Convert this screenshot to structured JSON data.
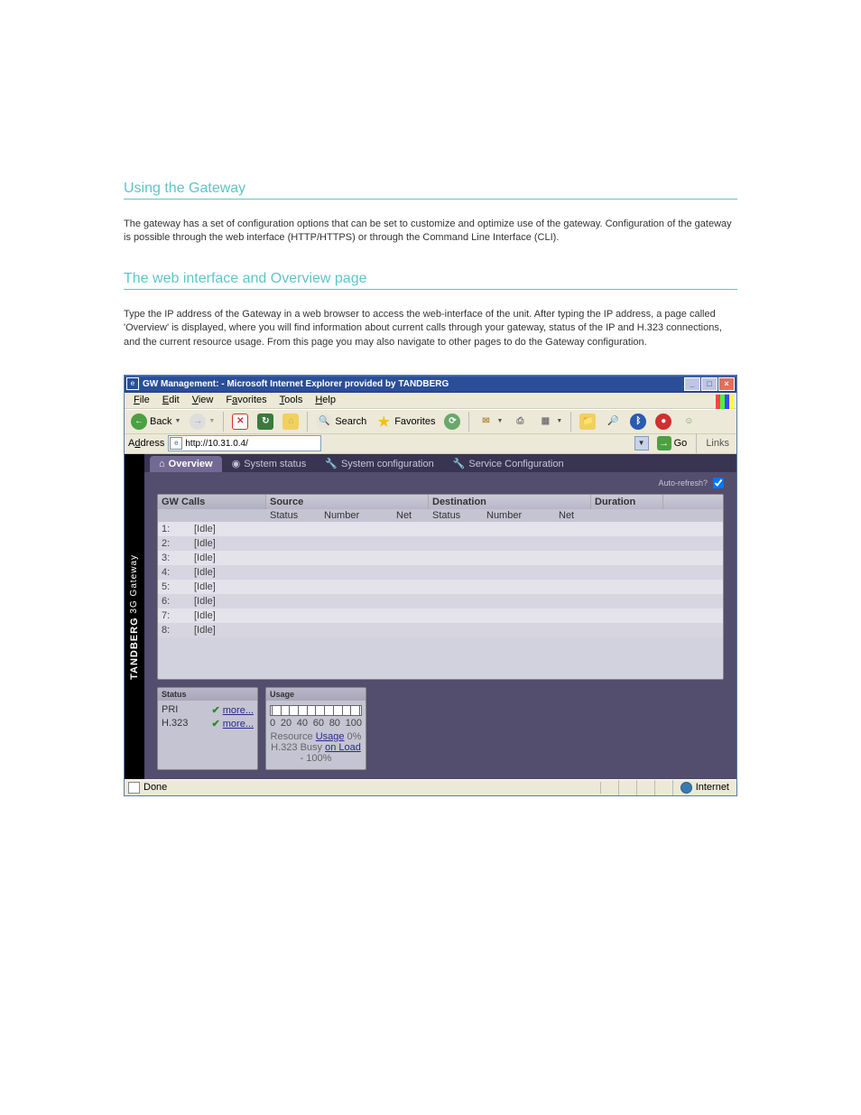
{
  "doc": {
    "sec1_title": "Using the Gateway",
    "sec1_body": "The gateway has a set of configuration options that can be set to customize and optimize use of the gateway. Configuration of the gateway is possible through the web interface (HTTP/HTTPS) or through the Command Line Interface (CLI).",
    "sec2_title": "The web interface and Overview page",
    "sec2_body": "Type the IP address of the Gateway in a web browser to access the web-interface of the unit. After typing the IP address, a page called 'Overview' is displayed, where you will find information about current calls through your gateway, status of the IP and H.323 connections, and the current resource usage. From this page you may also navigate to other pages to do the Gateway configuration."
  },
  "window": {
    "title": "GW Management: - Microsoft Internet Explorer provided by TANDBERG",
    "menu": [
      "File",
      "Edit",
      "View",
      "Favorites",
      "Tools",
      "Help"
    ],
    "back": "Back",
    "search": "Search",
    "favorites": "Favorites",
    "address_label": "Address",
    "url": "http://10.31.0.4/",
    "go": "Go",
    "links": "Links",
    "statusbar_done": "Done",
    "statusbar_zone": "Internet"
  },
  "app": {
    "sidebar": "TANDBERG 3G Gateway",
    "tabs": [
      {
        "icon": "home",
        "label": "Overview",
        "active": true
      },
      {
        "icon": "gear",
        "label": "System status"
      },
      {
        "icon": "wrench",
        "label": "System configuration"
      },
      {
        "icon": "wrench",
        "label": "Service Configuration"
      }
    ],
    "autorefresh": "Auto-refresh?",
    "table": {
      "group_calls": "GW Calls",
      "group_source": "Source",
      "group_dest": "Destination",
      "group_duration": "Duration",
      "sub_status": "Status",
      "sub_number": "Number",
      "sub_net": "Net",
      "rows": [
        {
          "n": "1:",
          "s": "[Idle]"
        },
        {
          "n": "2:",
          "s": "[Idle]"
        },
        {
          "n": "3:",
          "s": "[Idle]"
        },
        {
          "n": "4:",
          "s": "[Idle]"
        },
        {
          "n": "5:",
          "s": "[Idle]"
        },
        {
          "n": "6:",
          "s": "[Idle]"
        },
        {
          "n": "7:",
          "s": "[Idle]"
        },
        {
          "n": "8:",
          "s": "[Idle]"
        }
      ]
    },
    "status": {
      "title": "Status",
      "pri": "PRI",
      "h323": "H.323",
      "more": "more..."
    },
    "usage": {
      "title": "Usage",
      "t0": "0",
      "t20": "20",
      "t40": "40",
      "t60": "60",
      "t80": "80",
      "t100": "100",
      "resource_l": "Resource ",
      "resource_a": "Usage",
      "resource_r": " 0%",
      "busy_l": "H.323 Busy ",
      "busy_a": "on Load",
      "busy_r": " - 100%"
    }
  }
}
